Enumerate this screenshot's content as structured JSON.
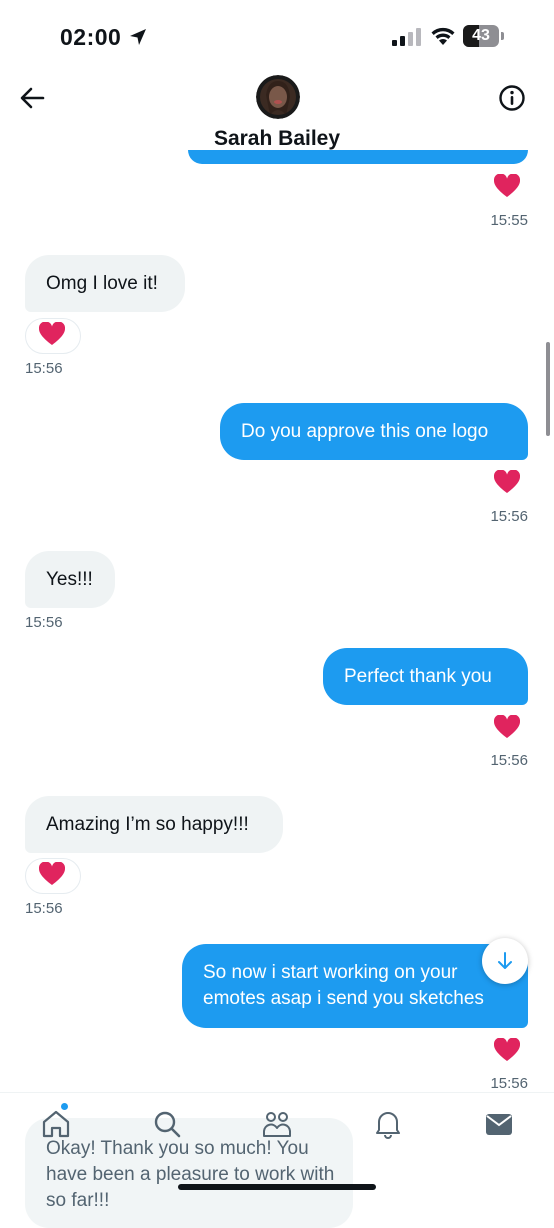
{
  "status_bar": {
    "time": "02:00",
    "battery": "43"
  },
  "header": {
    "contact_name": "Sarah Bailey"
  },
  "messages": [
    {
      "type": "reaction",
      "side": "out",
      "reaction": "heart",
      "time": "15:55"
    },
    {
      "type": "text",
      "side": "in",
      "text": "Omg I love it!",
      "reaction": "heart",
      "time": "15:56"
    },
    {
      "type": "text",
      "side": "out",
      "text": "Do you approve this one logo",
      "reaction": "heart",
      "time": "15:56"
    },
    {
      "type": "text",
      "side": "in",
      "text": "Yes!!!",
      "time": "15:56"
    },
    {
      "type": "text",
      "side": "out",
      "text": "Perfect thank you",
      "reaction": "heart",
      "time": "15:56"
    },
    {
      "type": "text",
      "side": "in",
      "text": "Amazing I’m so happy!!!",
      "reaction": "heart",
      "time": "15:56"
    },
    {
      "type": "text",
      "side": "out",
      "text": "So now i start working on your emotes asap i send you sketches",
      "reaction": "heart",
      "time": "15:56"
    },
    {
      "type": "text",
      "side": "in",
      "text": "Okay! Thank you so much! You have been a pleasure to work with so far!!!"
    }
  ],
  "bottom_nav": {
    "items": [
      "home-icon",
      "search-icon",
      "communities-icon",
      "notifications-icon",
      "messages-icon"
    ],
    "accent": "#1d9bf0"
  },
  "colors": {
    "outgoing_bubble": "#1d9bf0",
    "incoming_bubble": "#eff3f4",
    "heart": "#e0245e"
  }
}
